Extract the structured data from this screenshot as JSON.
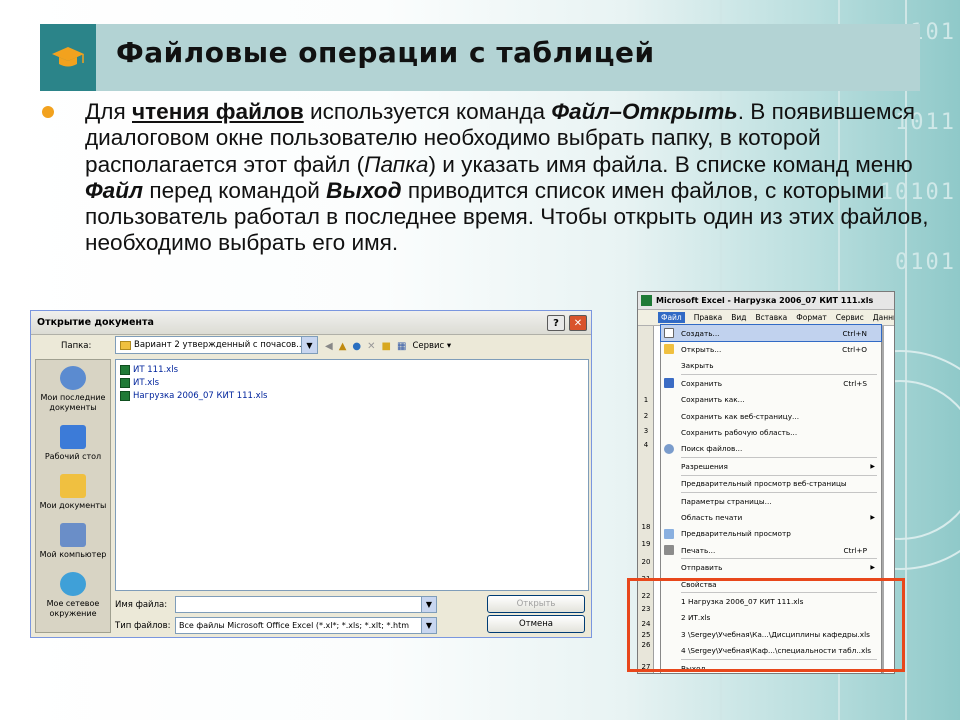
{
  "slide": {
    "title": "Файловые операции с таблицей",
    "paragraph": {
      "p1": "Для ",
      "p2": "чтения файлов",
      "p3": " используется команда ",
      "p4": "Файл–Открыть",
      "p5": ". В появившемся диалоговом окне пользователю необходимо выбрать папку, в которой располагается этот файл (",
      "p6": "Папка",
      "p7": ") и указать имя файла. В списке команд меню ",
      "p8": "Файл",
      "p9": " перед командой ",
      "p10": "Выход",
      "p11": " приводится список имен файлов, с которыми пользователь работал в последнее время. Чтобы открыть один из этих файлов, необходимо выбрать его имя."
    }
  },
  "open_dialog": {
    "title": "Открытие документа",
    "help_label": "?",
    "close_label": "✕",
    "look_in_label": "Папка:",
    "look_in_value": "Вариант 2 утвержденный с почасов...",
    "tools_label": "Сервис",
    "places": [
      {
        "label": "Мои последние документы"
      },
      {
        "label": "Рабочий стол"
      },
      {
        "label": "Мои документы"
      },
      {
        "label": "Мой компьютер"
      },
      {
        "label": "Мое сетевое окружение"
      }
    ],
    "files": [
      "ИТ 111.xls",
      "ИТ.xls",
      "Нагрузка 2006_07 КИТ 111.xls"
    ],
    "filename_label": "Имя файла:",
    "filename_value": "",
    "filetype_label": "Тип файлов:",
    "filetype_value": "Все файлы Microsoft Office Excel (*.xl*; *.xls; *.xlt; *.htm",
    "open_button": "Открыть",
    "cancel_button": "Отмена"
  },
  "excel": {
    "title": "Microsoft Excel - Нагрузка 2006_07 КИТ 111.xls",
    "menubar": [
      "Файл",
      "Правка",
      "Вид",
      "Вставка",
      "Формат",
      "Сервис",
      "Данные"
    ],
    "row_numbers": [
      "1",
      "2",
      "3",
      "4",
      "18",
      "19",
      "20",
      "21",
      "22",
      "23",
      "24",
      "25",
      "26",
      "27"
    ],
    "file_menu": {
      "create": {
        "label": "Создать...",
        "shortcut": "Ctrl+N"
      },
      "open": {
        "label": "Открыть...",
        "shortcut": "Ctrl+O"
      },
      "close": {
        "label": "Закрыть"
      },
      "save": {
        "label": "Сохранить",
        "shortcut": "Ctrl+S"
      },
      "save_as": {
        "label": "Сохранить как..."
      },
      "save_web": {
        "label": "Сохранить как веб-страницу..."
      },
      "save_workspace": {
        "label": "Сохранить рабочую область..."
      },
      "file_search": {
        "label": "Поиск файлов..."
      },
      "permissions": {
        "label": "Разрешения"
      },
      "web_preview": {
        "label": "Предварительный просмотр веб-страницы"
      },
      "page_setup": {
        "label": "Параметры страницы..."
      },
      "print_area": {
        "label": "Область печати"
      },
      "print_preview": {
        "label": "Предварительный просмотр"
      },
      "print": {
        "label": "Печать...",
        "shortcut": "Ctrl+P"
      },
      "send_to": {
        "label": "Отправить"
      },
      "properties": {
        "label": "Свойства"
      },
      "recent": [
        "1 Нагрузка 2006_07 КИТ 111.xls",
        "2 ИТ.xls",
        "3 \\Sergey\\Учебная\\Ка...\\Дисциплины кафедры.xls",
        "4 \\Sergey\\Учебная\\Каф...\\специальности табл..xls"
      ],
      "exit": {
        "label": "Выход"
      }
    }
  }
}
